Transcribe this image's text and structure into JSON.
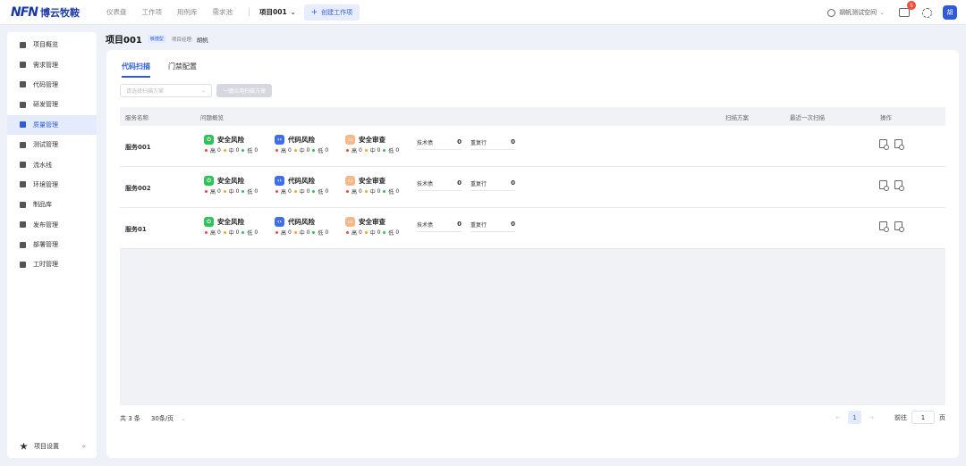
{
  "brand": {
    "mark": "NFN",
    "name": "博云牧鞍"
  },
  "topnav": {
    "items": [
      "仪表盘",
      "工作项",
      "用例库",
      "需求池"
    ],
    "separator": "|",
    "project": "项目001",
    "create": "创建工作项"
  },
  "topright": {
    "space": "胡帆测试空间",
    "badge": "5",
    "avatar": "胡"
  },
  "sidebar": {
    "items": [
      "项目概览",
      "需求管理",
      "代码管理",
      "研发管理",
      "质量管理",
      "测试管理",
      "流水线",
      "环境管理",
      "制品库",
      "发布管理",
      "部署管理",
      "工时管理"
    ],
    "active": "质量管理",
    "bottom": "项目设置",
    "collapse": "«"
  },
  "header": {
    "title": "项目001",
    "tag": "敏捷型",
    "manager_label": "项目经理:",
    "manager": "胡帆"
  },
  "tabs": [
    "代码扫描",
    "门禁配置"
  ],
  "toolbar": {
    "select_placeholder": "请选择扫描方案",
    "apply": "一键应用扫描方案"
  },
  "table": {
    "columns": [
      "服务名称",
      "问题概览",
      "扫描方案",
      "最近一次扫描",
      "操作"
    ],
    "modules": [
      {
        "name": "安全风险",
        "color": "#2fc25b"
      },
      {
        "name": "代码风险",
        "color": "#3e6fe8"
      },
      {
        "name": "安全审查",
        "color": "#f5b88a"
      }
    ],
    "levels": [
      "高",
      "中",
      "低"
    ],
    "rows": [
      {
        "name": "服务001",
        "counts": [
          [
            0,
            0,
            0
          ],
          [
            0,
            0,
            0
          ],
          [
            0,
            0,
            0
          ]
        ],
        "tech_debt_label": "技术债",
        "tech_debt": "0",
        "dup_label": "重复行",
        "dup": "0"
      },
      {
        "name": "服务002",
        "counts": [
          [
            0,
            0,
            0
          ],
          [
            0,
            0,
            0
          ],
          [
            0,
            0,
            0
          ]
        ],
        "tech_debt_label": "技术债",
        "tech_debt": "0",
        "dup_label": "重复行",
        "dup": "0"
      },
      {
        "name": "服务01",
        "counts": [
          [
            0,
            0,
            0
          ],
          [
            0,
            0,
            0
          ],
          [
            0,
            0,
            0
          ]
        ],
        "tech_debt_label": "技术债",
        "tech_debt": "0",
        "dup_label": "重复行",
        "dup": "0"
      }
    ]
  },
  "footer": {
    "total": "共 3 条",
    "per_page": "30条/页",
    "page": "1",
    "goto": "前往",
    "goto_value": "1",
    "page_suffix": "页"
  }
}
